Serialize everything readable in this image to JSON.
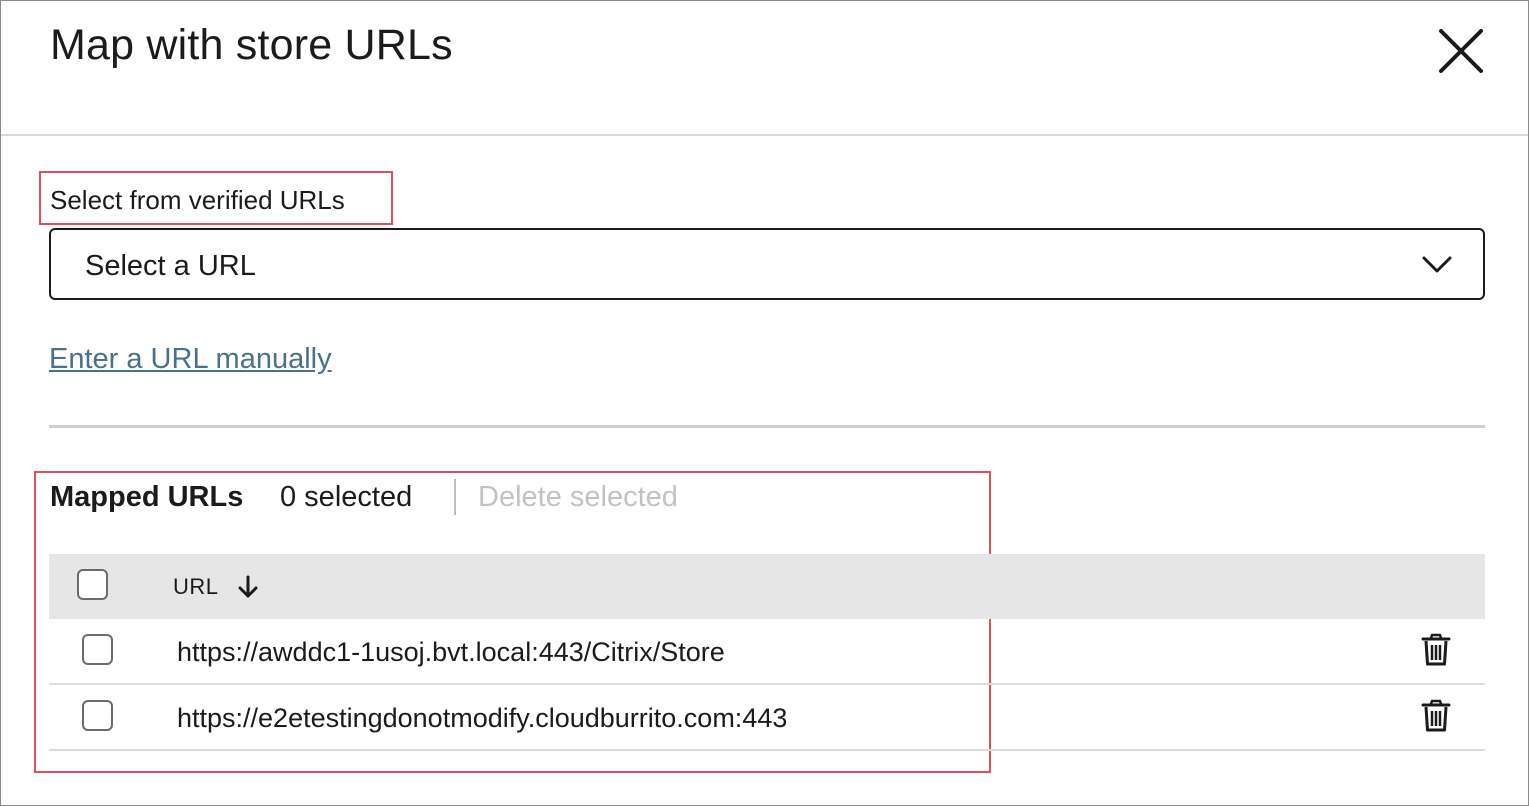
{
  "dialog": {
    "title": "Map with store URLs",
    "close_icon": "close-icon"
  },
  "verified": {
    "label": "Select from verified URLs",
    "select_value": "Select a URL",
    "dropdown_icon": "chevron-down-icon"
  },
  "manual_link": "Enter a URL manually",
  "mapped": {
    "title": "Mapped URLs",
    "selected_count": "0 selected",
    "delete_selected": "Delete selected"
  },
  "table": {
    "columns": [
      "URL"
    ],
    "sort_icon": "arrow-down-icon",
    "rows": [
      {
        "url": "https://awddc1-1usoj.bvt.local:443/Citrix/Store",
        "checked": false
      },
      {
        "url": "https://e2etestingdonotmodify.cloudburrito.com:443",
        "checked": false
      }
    ]
  },
  "colors": {
    "annotation": "#e0505a",
    "link": "#4a7186",
    "disabled_text": "#c2c2c2",
    "header_bg": "#e6e6e6"
  }
}
